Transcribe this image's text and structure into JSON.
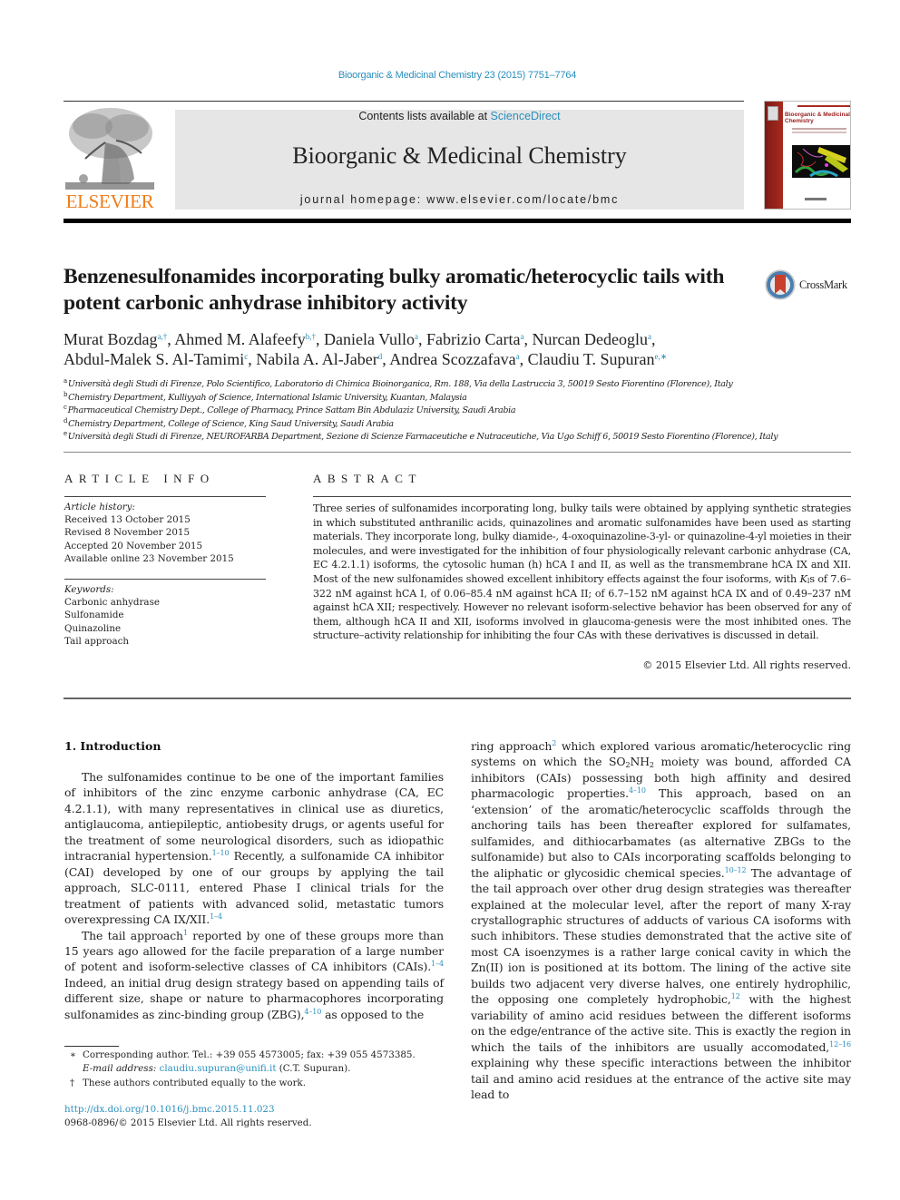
{
  "header": {
    "journal_ref": "Bioorganic & Medicinal Chemistry 23 (2015) 7751–7764",
    "contents_prefix": "Contents lists available at ",
    "contents_link": "ScienceDirect",
    "journal_title": "Bioorganic & Medicinal Chemistry",
    "homepage_line": "journal homepage: www.elsevier.com/locate/bmc",
    "publisher_logo_text": "ELSEVIER",
    "cover": {
      "title": "Bioorganic & Medicinal Chemistry"
    },
    "colors": {
      "link": "#2a8fbd",
      "elsevier_orange": "#ef7d1a",
      "banner_bg": "#e6e6e6",
      "cover_red": "#a82a20"
    }
  },
  "article": {
    "title": "Benzenesulfonamides incorporating bulky aromatic/heterocyclic tails with potent carbonic anhydrase inhibitory activity",
    "crossmark_label": "CrossMark",
    "authors": [
      {
        "name": "Murat Bozdag",
        "marks": "a,†",
        "sep": ", "
      },
      {
        "name": "Ahmed M. Alafeefy",
        "marks": "b,†",
        "sep": ", "
      },
      {
        "name": "Daniela Vullo",
        "marks": "a",
        "sep": ", "
      },
      {
        "name": "Fabrizio Carta",
        "marks": "a",
        "sep": ", "
      },
      {
        "name": "Nurcan Dedeoglu",
        "marks": "a",
        "sep": ","
      },
      {
        "name": "Abdul-Malek S. Al-Tamimi",
        "marks": "c",
        "sep": ", "
      },
      {
        "name": "Nabila A. Al-Jaber",
        "marks": "d",
        "sep": ", "
      },
      {
        "name": "Andrea Scozzafava",
        "marks": "a",
        "sep": ", "
      },
      {
        "name": "Claudiu T. Supuran",
        "marks": "e,∗",
        "sep": ""
      }
    ],
    "affiliations": [
      {
        "key": "a",
        "text": "Università degli Studi di Firenze, Polo Scientifico, Laboratorio di Chimica Bioinorganica, Rm. 188, Via della Lastruccia 3, 50019 Sesto Fiorentino (Florence), Italy"
      },
      {
        "key": "b",
        "text": "Chemistry Department, Kulliyyah of Science, International Islamic University, Kuantan, Malaysia"
      },
      {
        "key": "c",
        "text": "Pharmaceutical Chemistry Dept., College of Pharmacy, Prince Sattam Bin Abdulaziz University, Saudi Arabia"
      },
      {
        "key": "d",
        "text": "Chemistry Department, College of Science, King Saud University, Saudi Arabia"
      },
      {
        "key": "e",
        "text": "Università degli Studi di Firenze, NEUROFARBA Department, Sezione di Scienze Farmaceutiche e Nutraceutiche, Via Ugo Schiff 6, 50019 Sesto Fiorentino (Florence), Italy"
      }
    ]
  },
  "article_info": {
    "heading": "ARTICLE INFO",
    "history_label": "Article history:",
    "history": [
      "Received 13 October 2015",
      "Revised 8 November 2015",
      "Accepted 20 November 2015",
      "Available online 23 November 2015"
    ],
    "keywords_label": "Keywords:",
    "keywords": [
      "Carbonic anhydrase",
      "Sulfonamide",
      "Quinazoline",
      "Tail approach"
    ]
  },
  "abstract": {
    "heading": "ABSTRACT",
    "part1": "Three series of sulfonamides incorporating long, bulky tails were obtained by applying synthetic strategies in which substituted anthranilic acids, quinazolines and aromatic sulfonamides have been used as starting materials. They incorporate long, bulky diamide-, 4-oxoquinazoline-3-yl- or quinazoline-4-yl moieties in their molecules, and were investigated for the inhibition of four physiologically relevant carbonic anhydrase (CA, EC 4.2.1.1) isoforms, the cytosolic human (h) hCA I and II, as well as the transmembrane hCA IX and XII. Most of the new sulfonamides showed excellent inhibitory effects against the four isoforms, with ",
    "ki_symbol": "K",
    "ki_sub": "I",
    "ki_suffix": "s",
    "part2": " of 7.6–322 nM against hCA I, of 0.06–85.4 nM against hCA II; of 6.7–152 nM against hCA IX and of 0.49–237 nM against hCA XII; respectively. However no relevant isoform-selective behavior has been observed for any of them, although hCA II and XII, isoforms involved in glaucoma-genesis were the most inhibited ones. The structure–activity relationship for inhibiting the four CAs with these derivatives is discussed in detail.",
    "copyright": "© 2015 Elsevier Ltd. All rights reserved."
  },
  "body": {
    "section_title": "1. Introduction",
    "left": {
      "p1_a": "The sulfonamides continue to be one of the important families of inhibitors of the zinc enzyme carbonic anhydrase (CA, EC 4.2.1.1), with many representatives in clinical use as diuretics, antiglaucoma, antiepileptic, antiobesity drugs, or agents useful for the treatment of some neurological disorders, such as idiopathic intracranial hypertension.",
      "p1_ref1": "1–10",
      "p1_b": " Recently, a sulfonamide CA inhibitor (CAI) developed by one of our groups by applying the tail approach, SLC-0111, entered Phase I clinical trials for the treatment of patients with advanced solid, metastatic tumors overexpressing CA IX/XII.",
      "p1_ref2": "1–4",
      "p2_a": "The tail approach",
      "p2_ref1": "1",
      "p2_b": " reported by one of these groups more than 15 years ago allowed for the facile preparation of a large number of potent and isoform-selective classes of CA inhibitors (CAIs).",
      "p2_ref2": "1–4",
      "p2_c": " Indeed, an initial drug design strategy based on appending tails of different size, shape or nature to pharmacophores incorporating sulfonamides as zinc-binding group (ZBG),",
      "p2_ref3": "4–10",
      "p2_d": " as opposed to the"
    },
    "right": {
      "a": "ring approach",
      "ref1": "2",
      "b": " which explored various aromatic/heterocyclic ring systems on which the SO",
      "sub1": "2",
      "c": "NH",
      "sub2": "2",
      "d": " moiety was bound, afforded CA inhibitors (CAIs) possessing both high affinity and desired pharmacologic properties.",
      "ref2": "4–10",
      "e": " This approach, based on an ‘extension’ of the aromatic/heterocyclic scaffolds through the anchoring tails has been thereafter explored for sulfamates, sulfamides, and dithiocarbamates (as alternative ZBGs to the sulfonamide) but also to CAIs incorporating scaffolds belonging to the aliphatic or glycosidic chemical species.",
      "ref3": "10–12",
      "f": " The advantage of the tail approach over other drug design strategies was thereafter explained at the molecular level, after the report of many X-ray crystallographic structures of adducts of various CA isoforms with such inhibitors. These studies demonstrated that the active site of most CA isoenzymes is a rather large conical cavity in which the Zn(II) ion is positioned at its bottom. The lining of the active site builds two adjacent very diverse halves, one entirely hydrophilic, the opposing one completely hydrophobic,",
      "ref4": "12",
      "g": " with the highest variability of amino acid residues between the different isoforms on the edge/entrance of the active site. This is exactly the region in which the tails of the inhibitors are usually accomodated,",
      "ref5": "12–16",
      "h": " explaining why these specific interactions between the inhibitor tail and amino acid residues at the entrance of the active site may lead to"
    }
  },
  "footnotes": {
    "corr_mark": "∗",
    "corr_text": "Corresponding author. Tel.: +39 055 4573005; fax: +39 055 4573385.",
    "email_label": "E-mail address: ",
    "email": "claudiu.supuran@unifi.it",
    "email_suffix": " (C.T. Supuran).",
    "dagger_mark": "†",
    "dagger_text": "These authors contributed equally to the work.",
    "doi": "http://dx.doi.org/10.1016/j.bmc.2015.11.023",
    "issn": "0968-0896/© 2015 Elsevier Ltd. All rights reserved."
  }
}
